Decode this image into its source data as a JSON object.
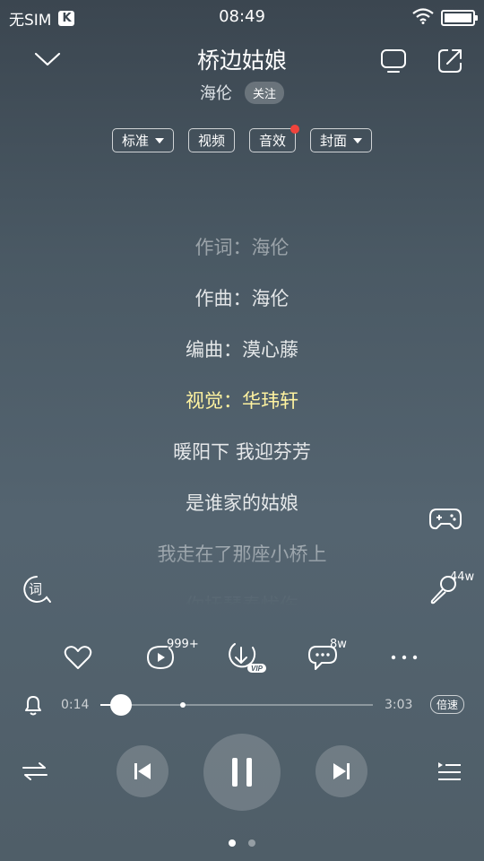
{
  "status_bar": {
    "carrier": "无SIM",
    "app_badge": "K",
    "time": "08:49",
    "battery_level": 1.0
  },
  "header": {
    "song_title": "桥边姑娘",
    "artist": "海伦",
    "follow_label": "关注"
  },
  "pills": [
    {
      "label": "标准",
      "dropdown": true
    },
    {
      "label": "视频",
      "dropdown": false
    },
    {
      "label": "音效",
      "dropdown": false,
      "notification_dot": true
    },
    {
      "label": "封面",
      "dropdown": true
    }
  ],
  "lyrics": [
    "作词：海伦",
    "作曲：海伦",
    "编曲：漠心藤",
    "视觉：华玮轩",
    "暖阳下 我迎芬芳",
    "是谁家的姑娘",
    "我走在了那座小桥上",
    "你抚琴奏忧伤"
  ],
  "lyrics_active_index": 3,
  "side": {
    "lyric_icon_label": "词",
    "mic_count": "44w"
  },
  "actions": {
    "video_count": "999+",
    "vip_label": "VIP",
    "comment_count": "8w"
  },
  "progress": {
    "current": "0:14",
    "total": "3:03",
    "played_fraction": 0.077,
    "buffered_fraction": 0.304,
    "speed_label": "倍速"
  },
  "colors": {
    "active_lyric": "#fff3a0",
    "notification_dot": "#f0433c"
  },
  "pager": {
    "pages": 2,
    "current": 0
  }
}
